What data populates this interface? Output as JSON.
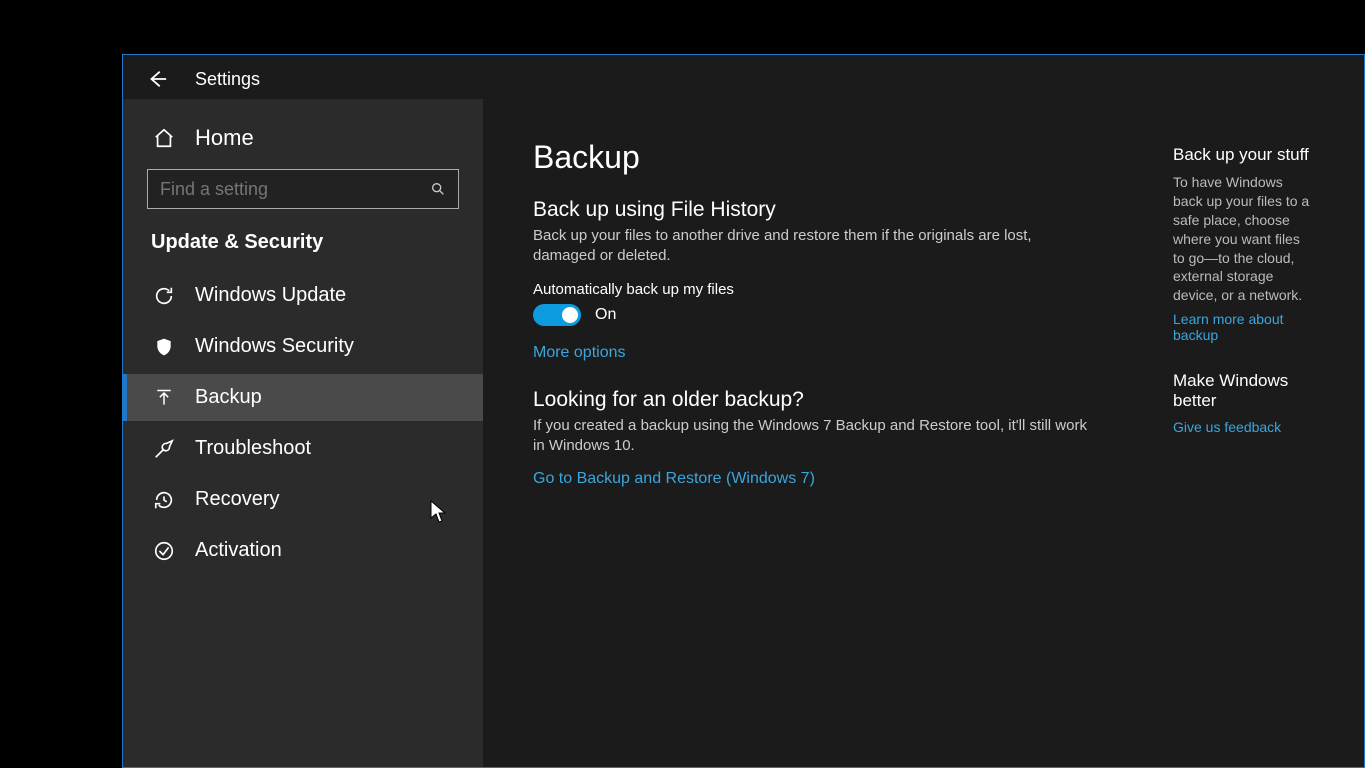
{
  "header": {
    "app_title": "Settings"
  },
  "sidebar": {
    "home_label": "Home",
    "search_placeholder": "Find a setting",
    "category_label": "Update & Security",
    "items": [
      {
        "icon": "sync-icon",
        "label": "Windows Update"
      },
      {
        "icon": "shield-icon",
        "label": "Windows Security"
      },
      {
        "icon": "backup-arrow-icon",
        "label": "Backup",
        "selected": true
      },
      {
        "icon": "wrench-icon",
        "label": "Troubleshoot"
      },
      {
        "icon": "history-icon",
        "label": "Recovery"
      },
      {
        "icon": "check-circle-icon",
        "label": "Activation"
      }
    ]
  },
  "main": {
    "title": "Backup",
    "section1": {
      "title": "Back up using File History",
      "desc": "Back up your files to another drive and restore them if the originals are lost, damaged or deleted.",
      "toggle_label": "Automatically back up my files",
      "toggle_state": "On",
      "more_options": "More options"
    },
    "section2": {
      "title": "Looking for an older backup?",
      "desc": "If you created a backup using the Windows 7 Backup and Restore tool, it'll still work in Windows 10.",
      "link": "Go to Backup and Restore (Windows 7)"
    }
  },
  "sidepanel": {
    "heading1": "Back up your stuff",
    "text1": "To have Windows back up your files to a safe place, choose where you want files to go—to the cloud, external storage device, or a network.",
    "link1": "Learn more about backup",
    "heading2": "Make Windows better",
    "link2": "Give us feedback"
  }
}
